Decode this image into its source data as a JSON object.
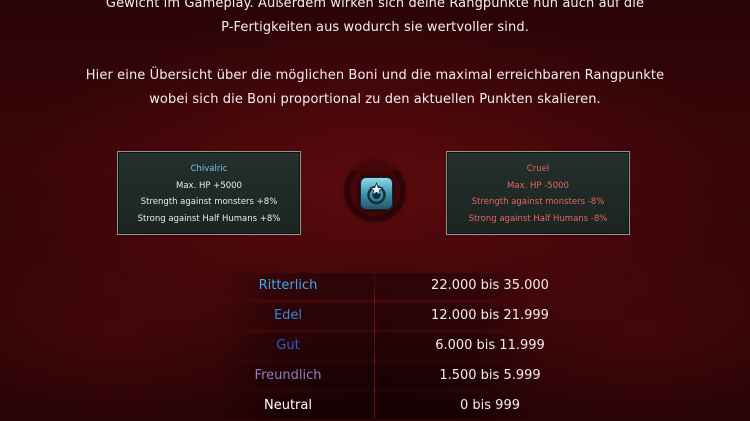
{
  "intro": {
    "line1": "Gewicht im Gameplay. Außerdem wirken sich deine Rangpunkte nun auch auf die",
    "line2": "P-Fertigkeiten aus wodurch sie wertvoller sind.",
    "line3": "Hier eine Übersicht über die möglichen Boni und die maximal erreichbaren Rangpunkte",
    "line4": "wobei sich die Boni proportional zu den aktuellen Punkten skalieren."
  },
  "tooltip_left": {
    "title": "Chivalric",
    "lines": [
      "Max. HP +5000",
      "Strength against monsters +8%",
      "Strong against Half Humans +8%"
    ]
  },
  "tooltip_right": {
    "title": "Cruel",
    "lines": [
      "Max. HP -5000",
      "Strength against monsters -8%",
      "Strong against Half Humans -8%"
    ]
  },
  "emblem": {
    "icon": "rank-emblem-icon"
  },
  "ranks": [
    {
      "name": "Ritterlich",
      "range": "22.000 bis 35.000",
      "color": "#3fa9f5"
    },
    {
      "name": "Edel",
      "range": "12.000 bis 21.999",
      "color": "#3a86d8"
    },
    {
      "name": "Gut",
      "range": "6.000 bis 11.999",
      "color": "#2f5bd0"
    },
    {
      "name": "Freundlich",
      "range": "1.500 bis 5.999",
      "color": "#8a7fc8"
    },
    {
      "name": "Neutral",
      "range": "0 bis 999",
      "color": "#ffffff"
    }
  ]
}
